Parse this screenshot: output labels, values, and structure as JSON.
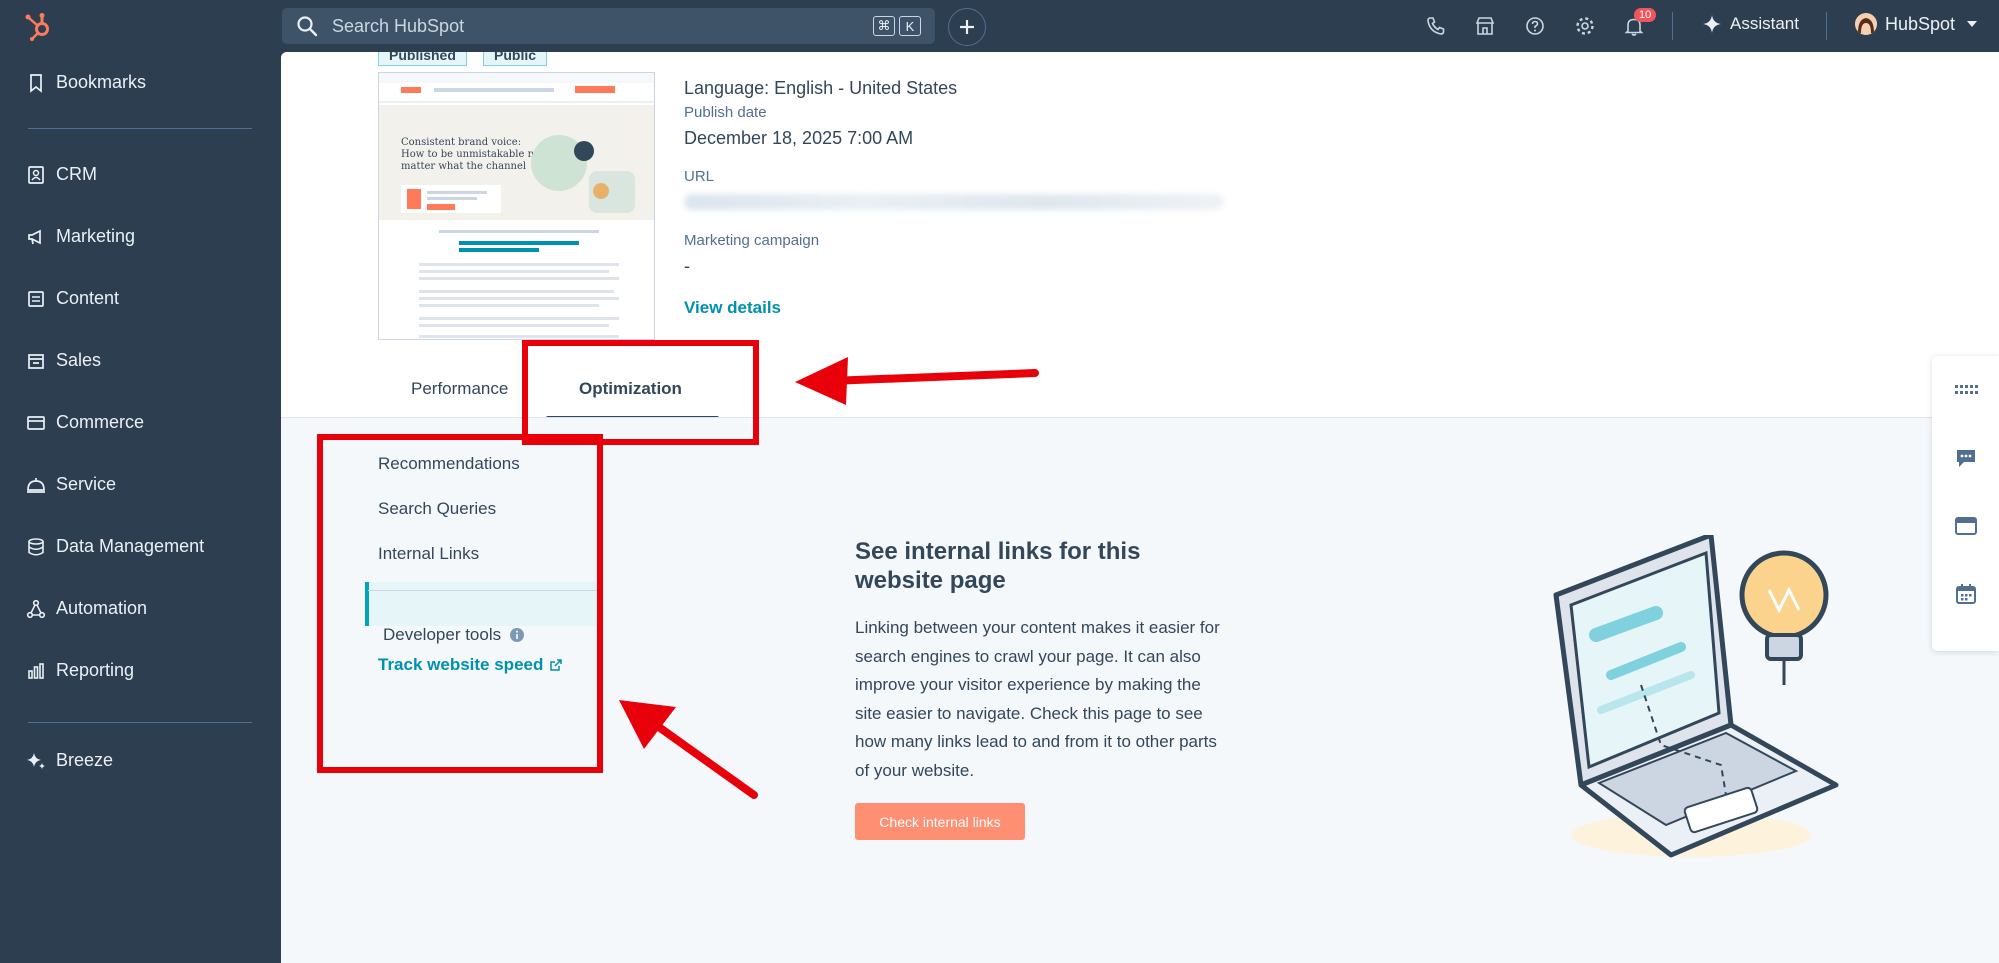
{
  "topbar": {
    "search_placeholder": "Search HubSpot",
    "shortcut_keys": [
      "⌘",
      "K"
    ],
    "notification_count": "10",
    "assistant_label": "Assistant",
    "account_name": "HubSpot",
    "icons": [
      "phone-icon",
      "marketplace-icon",
      "help-icon",
      "settings-icon",
      "bell-icon"
    ]
  },
  "sidebar": {
    "items": [
      {
        "label": "Bookmarks",
        "icon": "bookmark-icon"
      },
      {
        "label": "CRM",
        "icon": "crm-icon"
      },
      {
        "label": "Marketing",
        "icon": "megaphone-icon"
      },
      {
        "label": "Content",
        "icon": "content-icon"
      },
      {
        "label": "Sales",
        "icon": "sales-icon"
      },
      {
        "label": "Commerce",
        "icon": "commerce-icon"
      },
      {
        "label": "Service",
        "icon": "service-icon"
      },
      {
        "label": "Data Management",
        "icon": "database-icon"
      },
      {
        "label": "Automation",
        "icon": "automation-icon"
      },
      {
        "label": "Reporting",
        "icon": "reporting-icon"
      },
      {
        "label": "Breeze",
        "icon": "breeze-icon"
      }
    ]
  },
  "page": {
    "status_chips": [
      "Published",
      "Public"
    ],
    "language": "Language: English - United States",
    "publish_date_label": "Publish date",
    "publish_date": "December 18, 2025 7:00 AM",
    "url_label": "URL",
    "campaign_label": "Marketing campaign",
    "campaign_value": "-",
    "view_details": "View details",
    "thumbnail": {
      "headline": "Consistent brand voice: How to be unmistakable no matter what the channel",
      "badge": "Consistent Brand Voice",
      "link": "Free Download: How to Create a Style Guide [+ Free Template]"
    }
  },
  "tabs": [
    {
      "label": "Performance",
      "active": false
    },
    {
      "label": "Optimization",
      "active": true
    }
  ],
  "optimization_menu": {
    "items": [
      {
        "label": "Recommendations",
        "active": false
      },
      {
        "label": "Search Queries",
        "active": false
      },
      {
        "label": "Internal Links",
        "active": true
      }
    ],
    "developer_tools_label": "Developer tools",
    "track_speed_link": "Track website speed"
  },
  "empty_state": {
    "title": "See internal links for this website page",
    "body": "Linking between your content makes it easier for search engines to crawl your page. It can also improve your visitor experience by making the site easier to navigate. Check this page to see how many links lead to and from it to other parts of your website.",
    "button": "Check internal links"
  },
  "colors": {
    "nav_bg": "#2d3e50",
    "link": "#0091ae",
    "cta": "#ff8f73",
    "annotation_red": "#e8000b"
  }
}
